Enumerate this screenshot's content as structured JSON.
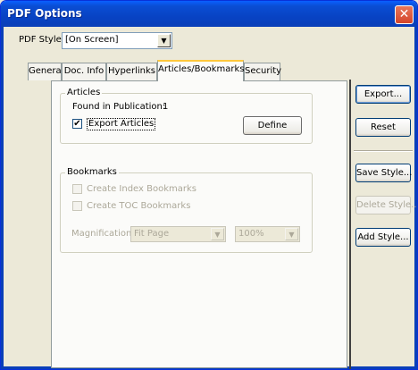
{
  "window": {
    "title": "PDF Options",
    "close_glyph": "✕"
  },
  "pdf_style": {
    "label": "PDF Style:",
    "value": "[On Screen]"
  },
  "tabs": [
    {
      "label": "General"
    },
    {
      "label": "Doc. Info"
    },
    {
      "label": "Hyperlinks"
    },
    {
      "label": "Articles/Bookmarks"
    },
    {
      "label": "Security"
    }
  ],
  "articles": {
    "group_label": "Articles",
    "found_label": "Found in Publication:",
    "found_value": "1",
    "export_label": "Export Articles",
    "export_checked": "✔",
    "define_button": "Define"
  },
  "bookmarks": {
    "group_label": "Bookmarks",
    "index_label": "Create Index Bookmarks",
    "toc_label": "Create TOC Bookmarks",
    "magnification_label": "Magnification:",
    "magnification_value": "Fit Page",
    "zoom_value": "100%"
  },
  "side_buttons": {
    "export": "Export...",
    "reset": "Reset",
    "save_style": "Save Style...",
    "delete_style": "Delete Style...",
    "add_style": "Add Style..."
  },
  "glyphs": {
    "dropdown_arrow": "▼"
  }
}
